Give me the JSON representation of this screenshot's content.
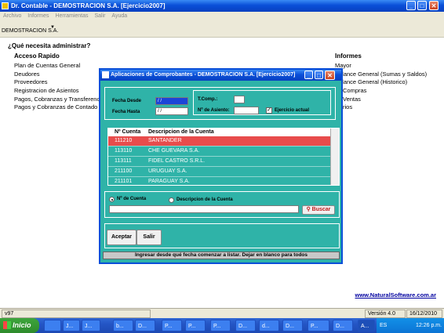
{
  "window": {
    "title": "Dr. Contable - DEMOSTRACION S.A.  [Ejercicio2007]"
  },
  "menu": [
    "Archivo",
    "Informes",
    "Herramientas",
    "Salir",
    "Ayuda"
  ],
  "toolbar": {
    "company": "DEMOSTRACION S.A.",
    "arrow": "▼"
  },
  "main": {
    "question": "¿Qué necesita administrar?",
    "quick_title": "Acceso Rapido",
    "quick_links": [
      "Plan de Cuentas General",
      "Deudores",
      "Proveedores",
      "Registracion de Asientos",
      "Pagos, Cobranzas y Transferencias",
      "Pagos y Cobranzas de Contado"
    ],
    "reports_title": "Informes",
    "report_links": [
      "Mayor",
      "alance General (Sumas y Saldos)",
      "alance General (Historico)",
      "Compras",
      "Ventas",
      "rios"
    ],
    "website": "www.NaturalSoftware.com.ar"
  },
  "status": {
    "left": "v97",
    "version": "Versión 4.0",
    "date": "16/12/2010"
  },
  "taskbar": {
    "start": "Inicio",
    "tasks": [
      "",
      "J...",
      "b...",
      "D...",
      "P...",
      "P...",
      "P...",
      "d...",
      "D...",
      "P...",
      "D...",
      "A..."
    ],
    "lang": "ES",
    "clock": "12:26 p.m."
  },
  "dialog": {
    "title": "Aplicaciones de Comprobantes - DEMOSTRACION S.A.  [Ejercicio2007]",
    "fecha_desde_label": "Fecha Desde",
    "fecha_desde_value": " / /",
    "fecha_hasta_label": "Fecha Hasta",
    "fecha_hasta_value": " / /",
    "tcomp_label": "T.Comp.:",
    "nro_asiento_label": "Nº de Asiento:",
    "ejercicio_label": "Ejercicio actual",
    "ejercicio_checked": "✓",
    "grid_headers": [
      "Nº Cuenta",
      "Descripcion de la Cuenta"
    ],
    "rows": [
      {
        "num": "111210",
        "desc": "SANTANDER"
      },
      {
        "num": "113110",
        "desc": "CHE GUEVARA S.A."
      },
      {
        "num": "113111",
        "desc": "FIDEL CASTRO S.R.L."
      },
      {
        "num": "211100",
        "desc": "URUGUAY S.A."
      },
      {
        "num": "211101",
        "desc": "PARAGUAY S.A."
      }
    ],
    "radio_num_label": "Nº de Cuenta",
    "radio_desc_label": "Descripcion de la Cuenta",
    "search_label": "Buscar",
    "accept_label": "Aceptar",
    "exit_label": "Salir",
    "hint": "Ingresar desde qué fecha comenzar a listar. Dejar en blanco para todos"
  }
}
